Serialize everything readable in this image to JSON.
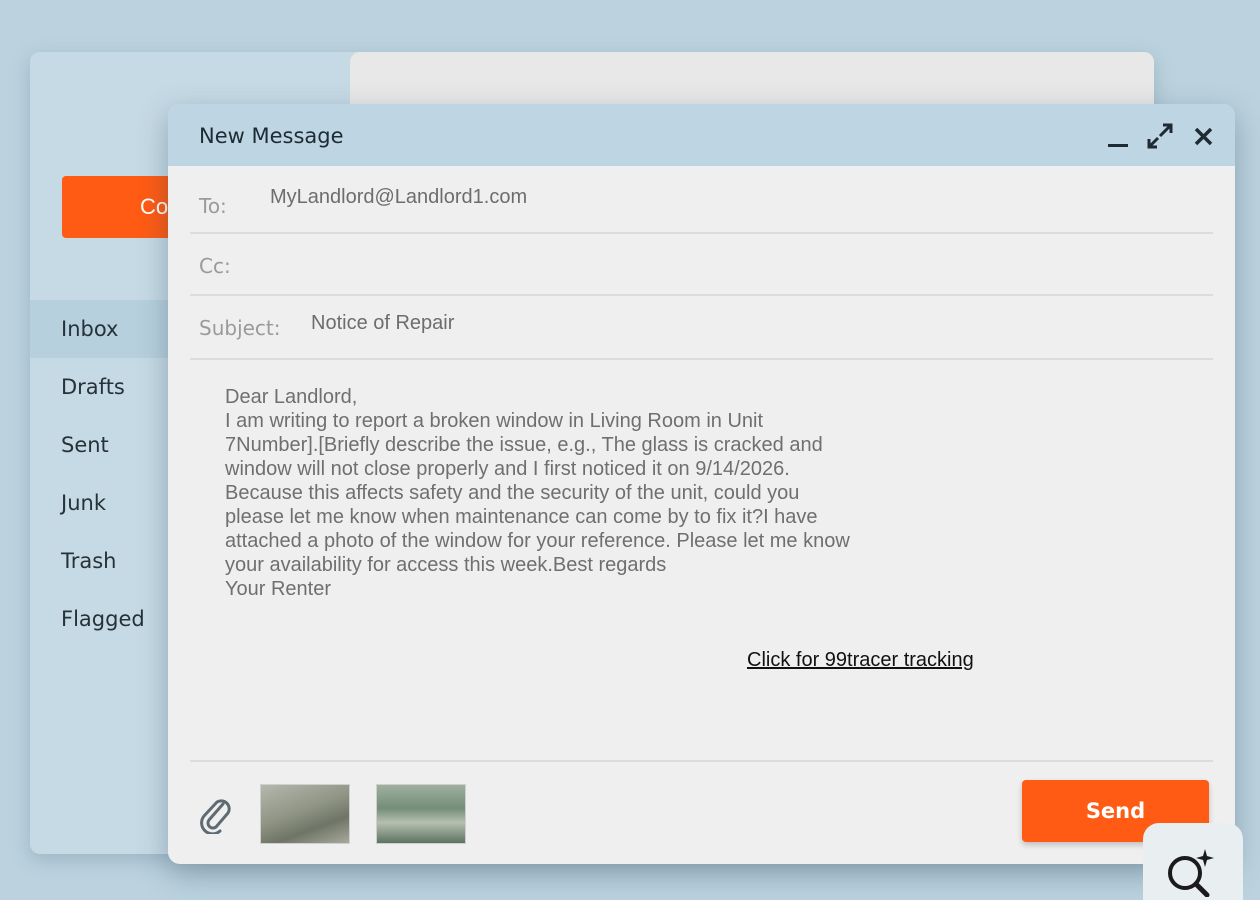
{
  "app": {
    "compose_label": "Co",
    "folders": [
      {
        "label": "Inbox",
        "active": true
      },
      {
        "label": "Drafts",
        "active": false
      },
      {
        "label": "Sent",
        "active": false
      },
      {
        "label": "Junk",
        "active": false
      },
      {
        "label": "Trash",
        "active": false
      },
      {
        "label": "Flagged",
        "active": false
      }
    ]
  },
  "compose": {
    "title": "New Message",
    "to_label": "To:",
    "to_value": "MyLandlord@Landlord1.com",
    "cc_label": "Cc:",
    "cc_value": "",
    "subject_label": "Subject:",
    "subject_value": "Notice of Repair",
    "body_lines": [
      "Dear Landlord,",
      "I am writing to report a broken window in Living Room in Unit",
      "7Number].[Briefly describe the issue, e.g., The glass is cracked and",
      "window will not close properly and I first noticed it on 9/14/2026.",
      "Because this affects safety and the security of the unit, could you",
      "please let me know when maintenance can come by to fix it?I have",
      "attached a photo of the window for your reference. Please let me know",
      "your availability for access this week.Best regards",
      "Your Renter"
    ],
    "tracking_link": "Click for 99tracer tracking",
    "send_label": "Send",
    "attachments": [
      "image-thumbnail",
      "image-thumbnail"
    ]
  },
  "colors": {
    "accent": "#ff5b14",
    "header_bg": "#bed6e3",
    "page_bg": "#bcd3df"
  },
  "icons": [
    "minimize-icon",
    "expand-icon",
    "close-icon",
    "paperclip-icon",
    "search-sparkle-icon"
  ]
}
